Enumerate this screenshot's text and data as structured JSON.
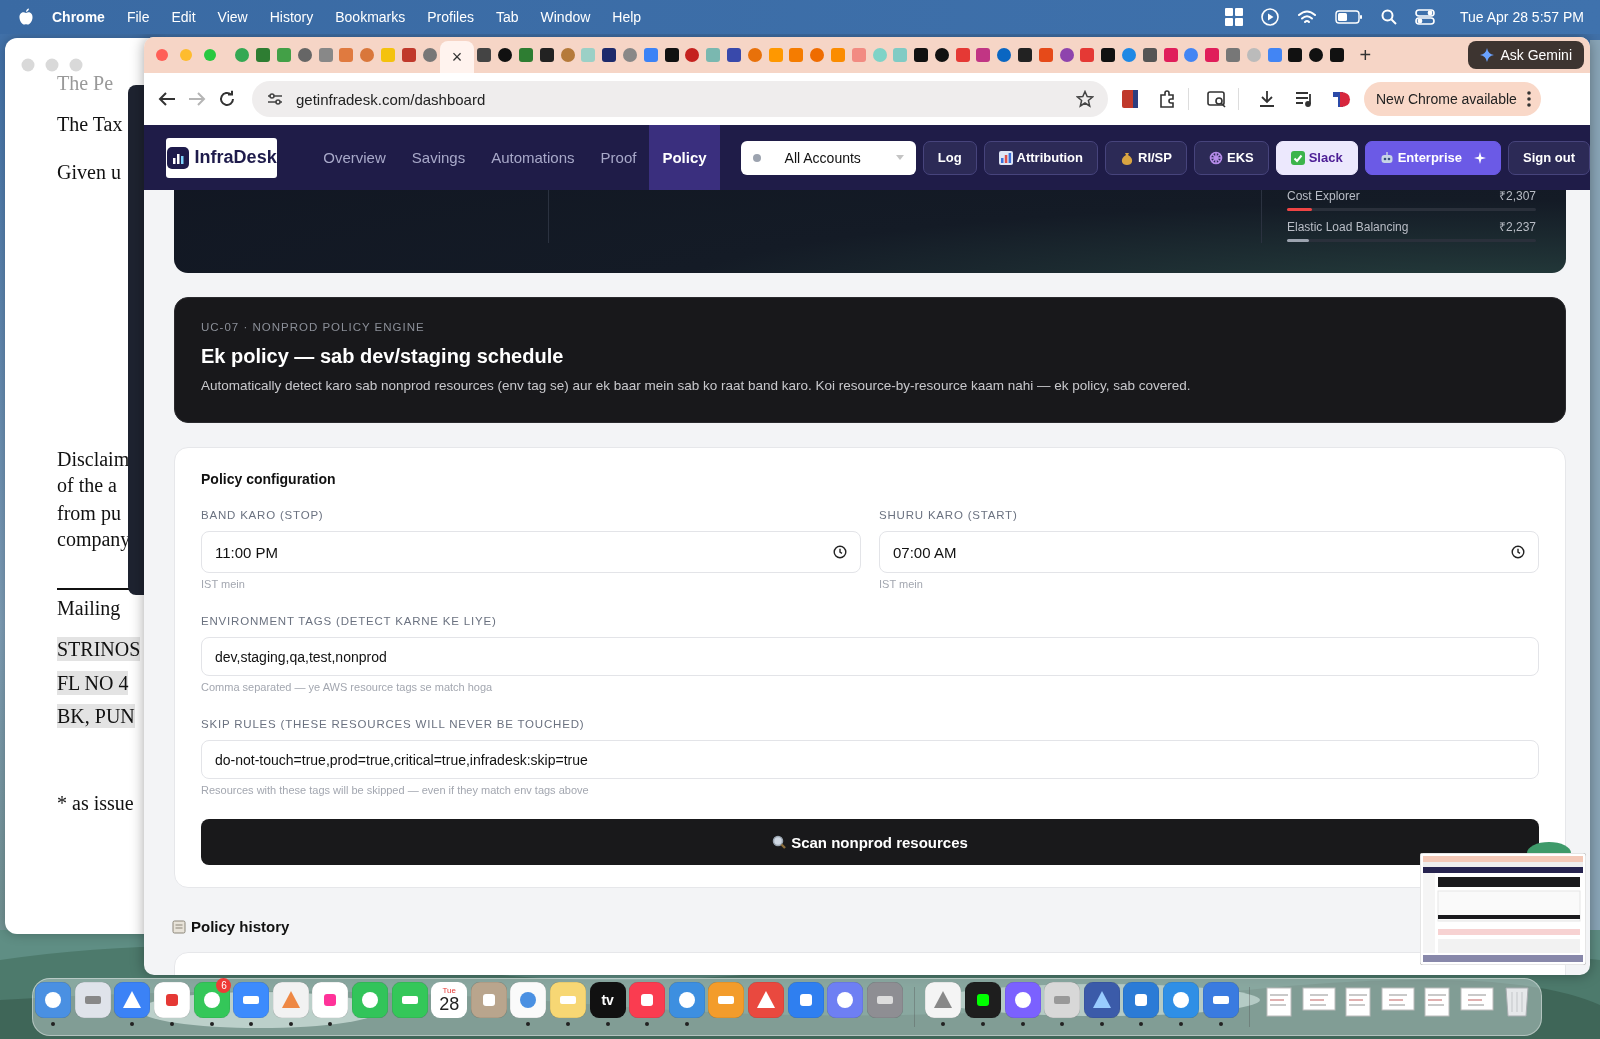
{
  "menu_bar": {
    "app": "Chrome",
    "items": [
      "File",
      "Edit",
      "View",
      "History",
      "Bookmarks",
      "Profiles",
      "Tab",
      "Window",
      "Help"
    ],
    "clock": "Tue Apr 28  5:57 PM"
  },
  "background_window": {
    "lines": [
      {
        "text": "The Pe",
        "kind": "faded"
      },
      {
        "text": "The Tax",
        "kind": "body"
      },
      {
        "text": "Given u",
        "kind": "body"
      },
      {
        "text": "Disclaim",
        "kind": "body"
      },
      {
        "text": "of the a",
        "kind": "body"
      },
      {
        "text": "from pu",
        "kind": "body"
      },
      {
        "text": "company",
        "kind": "body"
      },
      {
        "text": "Mailing",
        "kind": "body"
      },
      {
        "text": "STRINOS",
        "kind": "highlight"
      },
      {
        "text": "FL NO 4",
        "kind": "highlight"
      },
      {
        "text": "BK, PUN",
        "kind": "highlight"
      },
      {
        "text": "* as issue",
        "kind": "body"
      }
    ]
  },
  "browser": {
    "tabs": [
      {
        "selected": false
      },
      {
        "selected": false
      },
      {
        "selected": false
      },
      {
        "selected": false
      },
      {
        "selected": false
      },
      {
        "selected": false
      },
      {
        "selected": false
      },
      {
        "selected": false
      },
      {
        "selected": false
      },
      {
        "selected": false
      },
      {
        "selected": true,
        "close": "×"
      },
      {
        "selected": false
      },
      {
        "selected": false
      },
      {
        "selected": false
      },
      {
        "selected": false
      },
      {
        "selected": false
      },
      {
        "selected": false
      },
      {
        "selected": false
      },
      {
        "selected": false
      },
      {
        "selected": false
      },
      {
        "selected": false
      },
      {
        "selected": false
      },
      {
        "selected": false
      },
      {
        "selected": false
      },
      {
        "selected": false
      },
      {
        "selected": false
      },
      {
        "selected": false
      },
      {
        "selected": false
      },
      {
        "selected": false
      },
      {
        "selected": false
      },
      {
        "selected": false
      },
      {
        "selected": false
      },
      {
        "selected": false
      },
      {
        "selected": false
      },
      {
        "selected": false
      },
      {
        "selected": false
      },
      {
        "selected": false
      },
      {
        "selected": false
      },
      {
        "selected": false
      },
      {
        "selected": false
      },
      {
        "selected": false
      },
      {
        "selected": false
      },
      {
        "selected": false
      },
      {
        "selected": false
      },
      {
        "selected": false
      },
      {
        "selected": false
      },
      {
        "selected": false
      },
      {
        "selected": false
      },
      {
        "selected": false
      },
      {
        "selected": false
      },
      {
        "selected": false
      },
      {
        "selected": false
      },
      {
        "selected": false
      }
    ],
    "new_tab": "+",
    "gemini_button": "Ask Gemini",
    "toolbar": {
      "url": "getinfradesk.com/dashboard",
      "forward_disabled": true,
      "update_button": "New Chrome available"
    }
  },
  "app": {
    "logo": "InfraDesk",
    "nav": [
      {
        "label": "Overview",
        "selected": false
      },
      {
        "label": "Savings",
        "selected": false
      },
      {
        "label": "Automations",
        "selected": false
      },
      {
        "label": "Proof",
        "selected": false
      },
      {
        "label": "Policy",
        "selected": true
      }
    ],
    "account": "All Accounts",
    "actions": [
      {
        "label": "Log",
        "kind": "dark"
      },
      {
        "label": "Attribution",
        "kind": "dark"
      },
      {
        "label": "RI/SP",
        "kind": "dark"
      },
      {
        "label": "EKS",
        "kind": "dark"
      },
      {
        "label": "Slack",
        "kind": "light"
      },
      {
        "label": "Enterprise",
        "kind": "accent"
      },
      {
        "label": "Sign out",
        "kind": "dark"
      }
    ],
    "top_card": {
      "metrics": [
        {
          "name": "Cost Explorer",
          "value": "₹2,307",
          "level": 0.1,
          "color": "#ef4444"
        },
        {
          "name": "Elastic Load Balancing",
          "value": "₹2,237",
          "level": 0.09,
          "color": "#9ca3af"
        }
      ]
    },
    "policy_banner": {
      "eyebrow": "UC-07 · NONPROD POLICY ENGINE",
      "title": "Ek policy — sab dev/staging schedule",
      "description": "Automatically detect karo sab nonprod resources (env tag se) aur ek baar mein sab ko raat band karo. Koi resource-by-resource kaam nahi — ek policy, sab covered."
    },
    "config": {
      "title": "Policy configuration",
      "time_fields": [
        {
          "label": "BAND KARO (STOP)",
          "value": "11:00 PM",
          "hint": "IST mein"
        },
        {
          "label": "SHURU KARO (START)",
          "value": "07:00 AM",
          "hint": "IST mein"
        }
      ],
      "text_fields": [
        {
          "label": "ENVIRONMENT TAGS (DETECT KARNE KE LIYE)",
          "value": "dev,staging,qa,test,nonprod",
          "hint": "Comma separated — ye AWS resource tags se match hoga"
        },
        {
          "label": "SKIP RULES (THESE RESOURCES WILL NEVER BE TOUCHED)",
          "value": "do-not-touch=true,prod=true,critical=true,infradesk:skip=true",
          "hint": "Resources with these tags will be skipped — even if they match env tags above"
        }
      ],
      "scan_button": "Scan nonprod resources"
    },
    "history_title": "Policy history"
  },
  "dock": {
    "sections": [
      [
        {
          "kind": "app",
          "running": true
        },
        {
          "kind": "app",
          "running": false
        },
        {
          "kind": "app",
          "running": true
        },
        {
          "kind": "app",
          "running": true
        },
        {
          "kind": "app",
          "running": true,
          "badge": "6"
        },
        {
          "kind": "app",
          "running": true
        },
        {
          "kind": "app",
          "running": true
        },
        {
          "kind": "app",
          "running": true
        },
        {
          "kind": "app",
          "running": false
        },
        {
          "kind": "app",
          "running": false
        },
        {
          "kind": "calendar",
          "running": false,
          "day": "Tue",
          "date": "28"
        },
        {
          "kind": "app",
          "running": false
        },
        {
          "kind": "app",
          "running": true
        },
        {
          "kind": "app",
          "running": true
        },
        {
          "kind": "tv",
          "running": true,
          "label": "tv"
        },
        {
          "kind": "app",
          "running": true
        },
        {
          "kind": "app",
          "running": true
        },
        {
          "kind": "app",
          "running": false
        },
        {
          "kind": "app",
          "running": false
        },
        {
          "kind": "app",
          "running": false
        },
        {
          "kind": "app",
          "running": false
        },
        {
          "kind": "app",
          "running": false
        }
      ],
      [
        {
          "kind": "app",
          "running": true
        },
        {
          "kind": "app",
          "running": true
        },
        {
          "kind": "app",
          "running": true
        },
        {
          "kind": "app",
          "running": true
        },
        {
          "kind": "app",
          "running": true
        },
        {
          "kind": "app",
          "running": true
        },
        {
          "kind": "app",
          "running": true
        },
        {
          "kind": "app",
          "running": true
        }
      ],
      [
        {
          "kind": "document",
          "running": false
        },
        {
          "kind": "document",
          "running": false
        },
        {
          "kind": "document",
          "running": false
        },
        {
          "kind": "document",
          "running": false
        },
        {
          "kind": "document",
          "running": false
        },
        {
          "kind": "document",
          "running": false
        },
        {
          "kind": "trash",
          "running": false
        }
      ]
    ]
  }
}
